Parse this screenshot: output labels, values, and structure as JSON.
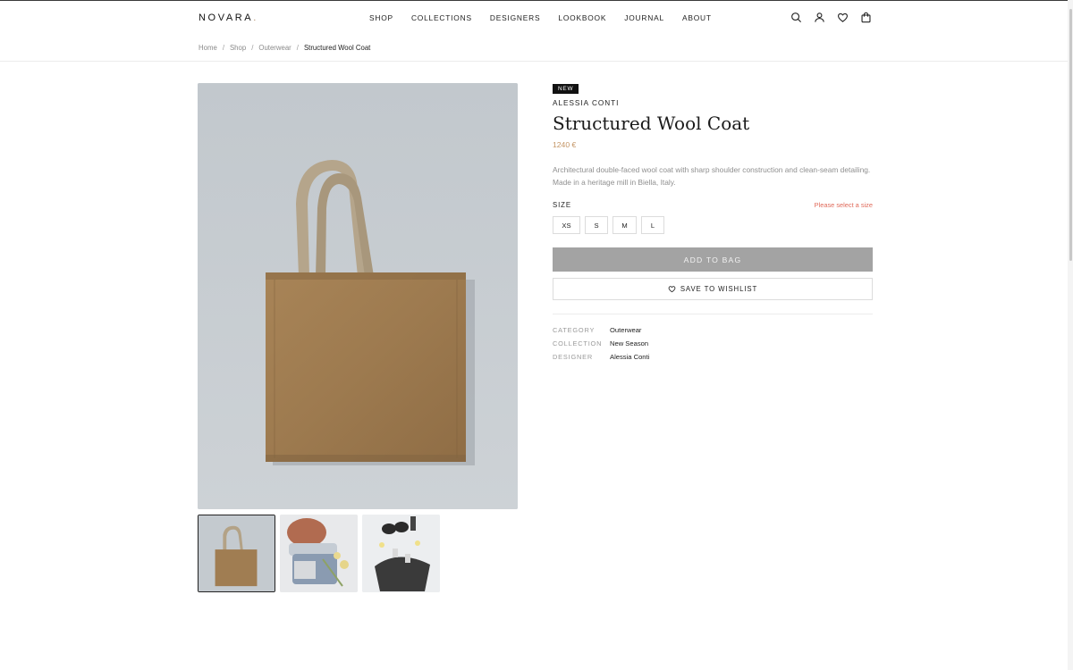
{
  "brand": {
    "name": "NOVARA",
    "dot": "."
  },
  "nav": [
    "SHOP",
    "COLLECTIONS",
    "DESIGNERS",
    "LOOKBOOK",
    "JOURNAL",
    "ABOUT"
  ],
  "header_icons": [
    "search-icon",
    "user-icon",
    "heart-icon",
    "bag-icon"
  ],
  "breadcrumb": {
    "items": [
      "Home",
      "Shop",
      "Outerwear"
    ],
    "current": "Structured Wool Coat",
    "separator": "/"
  },
  "gallery": {
    "main_image": "tote-bag-photo",
    "thumbnails": [
      "tote-bag-thumb",
      "knit-hat-jeans-thumb",
      "accessories-flatlay-thumb"
    ],
    "active_thumbnail": 0
  },
  "product": {
    "badge": "NEW",
    "designer": "ALESSIA CONTI",
    "title": "Structured Wool Coat",
    "price": "1240 €",
    "description": "Architectural double-faced wool coat with sharp shoulder construction and clean-seam detailing. Made in a heritage mill in Biella, Italy."
  },
  "size": {
    "label": "SIZE",
    "warning": "Please select a size",
    "options": [
      "XS",
      "S",
      "M",
      "L"
    ]
  },
  "actions": {
    "add_to_bag": "ADD TO BAG",
    "save_to_wishlist": "SAVE TO WISHLIST"
  },
  "details": {
    "category_label": "CATEGORY",
    "category_value": "Outerwear",
    "collection_label": "COLLECTION",
    "collection_value": "New Season",
    "designer_label": "DESIGNER",
    "designer_value": "Alessia Conti"
  },
  "colors": {
    "accent": "#c49565",
    "warning": "#e06a5a",
    "button_disabled": "#a3a3a3",
    "badge_bg": "#111111"
  }
}
